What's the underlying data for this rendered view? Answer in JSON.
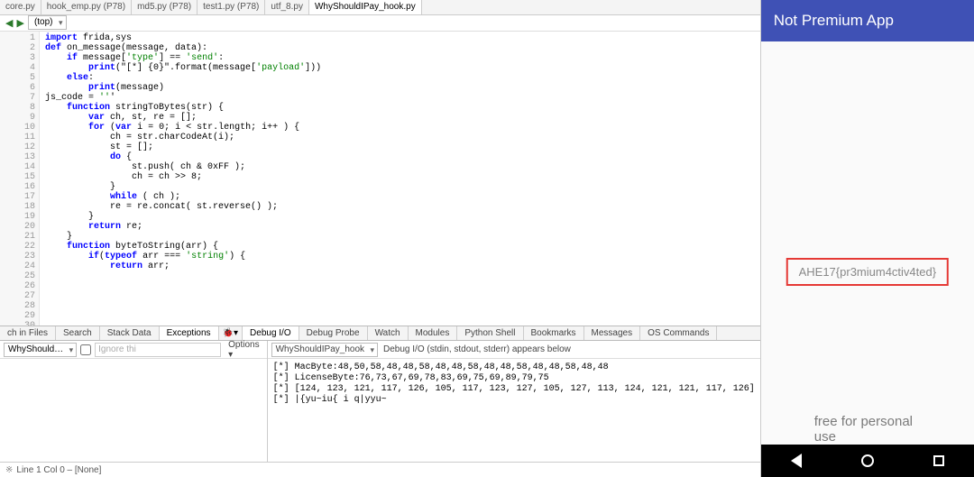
{
  "tabs": {
    "items": [
      {
        "label": "core.py"
      },
      {
        "label": "hook_emp.py (P78)"
      },
      {
        "label": "md5.py (P78)"
      },
      {
        "label": "test1.py (P78)"
      },
      {
        "label": "utf_8.py"
      },
      {
        "label": "WhyShouldIPay_hook.py"
      }
    ],
    "active_index": 5
  },
  "nav": {
    "scope_label": "(top)"
  },
  "code": {
    "lines": [
      "import frida,sys",
      "",
      "",
      "def on_message(message, data):",
      "    if message['type'] == 'send':",
      "        print(\"[*] {0}\".format(message['payload']))",
      "    else:",
      "        print(message)",
      "",
      "",
      "js_code = '''",
      "",
      "    function stringToBytes(str) {",
      "        var ch, st, re = [];",
      "        for (var i = 0; i < str.length; i++ ) {",
      "            ch = str.charCodeAt(i);",
      "            st = [];",
      "",
      "            do {",
      "                st.push( ch & 0xFF );",
      "                ch = ch >> 8;",
      "            }",
      "            while ( ch );",
      "            re = re.concat( st.reverse() );",
      "        }",
      "        return re;",
      "    }",
      "",
      "    function byteToString(arr) {",
      "        if(typeof arr === 'string') {",
      "            return arr;",
      ""
    ],
    "first_line_no": 1
  },
  "bottom_tabs_left": [
    "ch in Files",
    "Search",
    "Stack Data",
    "Exceptions"
  ],
  "bottom_tabs_left_active": 3,
  "bottom_tabs_right": [
    "Debug I/O",
    "Debug Probe",
    "Watch",
    "Modules",
    "Python Shell",
    "Bookmarks",
    "Messages",
    "OS Commands"
  ],
  "bottom_tabs_right_active": 0,
  "lower_left": {
    "select": "WhyShould…",
    "ignore_label": "Ignore thi",
    "options_label": "Options"
  },
  "lower_right": {
    "select": "WhyShouldIPay_hook",
    "caption": "Debug I/O (stdin, stdout, stderr) appears below",
    "console_lines": [
      "[*] MacByte:48,50,58,48,48,58,48,48,58,48,48,58,48,48,58,48,48",
      "[*] LicenseByte:76,73,67,69,78,83,69,75,69,89,79,75",
      "[*] [124, 123, 121, 117, 126, 105, 117, 123, 127, 105, 127, 113, 124, 121, 121, 117, 126]",
      "[*] |{yu~iu{ i q|yyu~"
    ]
  },
  "status_bar": "Line 1 Col 0 – [None]",
  "phone": {
    "title": "Not Premium App",
    "flag": "AHE17{pr3mium4ctiv4ted}",
    "watermark": "free for personal use"
  }
}
